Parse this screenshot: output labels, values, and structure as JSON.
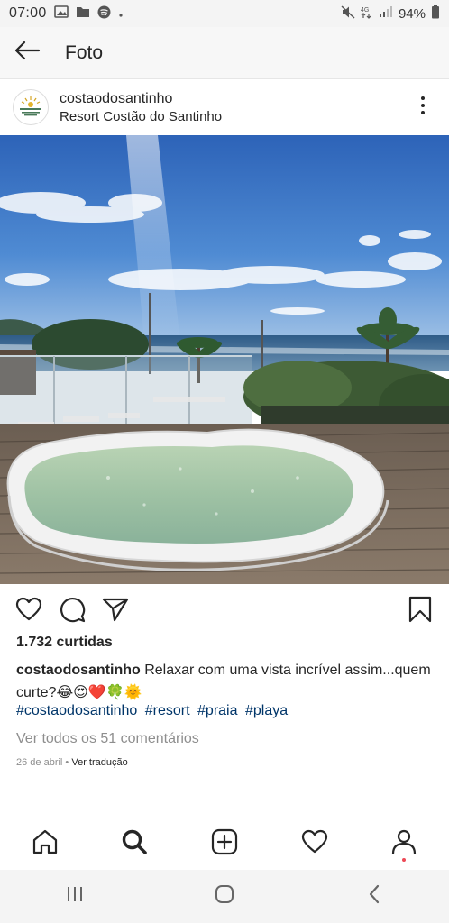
{
  "status_bar": {
    "time": "07:00",
    "battery": "94%",
    "network": "4G"
  },
  "header": {
    "title": "Foto"
  },
  "post": {
    "username": "costaodosantinho",
    "location": "Resort Costão do Santinho",
    "likes": "1.732 curtidas",
    "caption_user": "costaodosantinho",
    "caption_text": " Relaxar com uma vista incrível assim...quem curte?😂😍❤️🍀🌞",
    "hashtags": [
      "#costaodosantinho",
      "#resort",
      "#praia",
      "#playa"
    ],
    "view_comments": "Ver todos os 51 comentários",
    "date": "26 de abril",
    "separator": " • ",
    "translate": "Ver tradução"
  },
  "icons": {
    "back": "arrow-left-icon",
    "more": "more-vertical-icon",
    "like": "heart-icon",
    "comment": "comment-icon",
    "share": "send-icon",
    "save": "bookmark-icon",
    "home": "home-icon",
    "search": "search-icon",
    "add": "add-post-icon",
    "activity": "heart-icon",
    "profile": "profile-icon"
  },
  "colors": {
    "hashtag": "#003569",
    "muted": "#8e8e8e",
    "notification": "#ed4956"
  }
}
